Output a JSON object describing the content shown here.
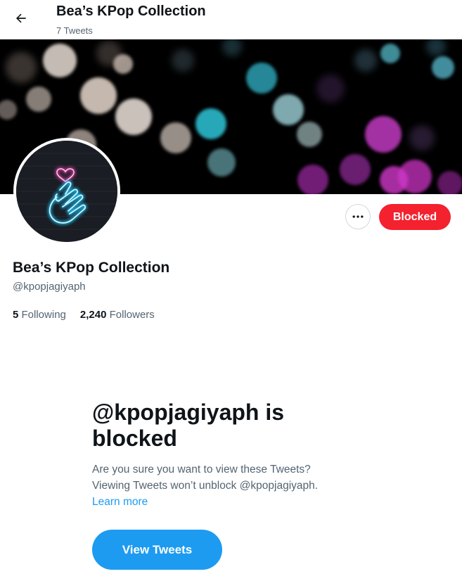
{
  "header": {
    "title": "Bea’s KPop Collection",
    "tweet_count": "7 Tweets",
    "back_icon": "arrow-left-icon"
  },
  "profile": {
    "name": "Bea’s KPop Collection",
    "handle": "@kpopjagiyaph",
    "following_count": "5",
    "following_label": "Following",
    "followers_count": "2,240",
    "followers_label": "Followers",
    "more_icon": "more-horizontal-icon",
    "blocked_button_label": "Blocked"
  },
  "blocked_notice": {
    "title": "@kpopjagiyaph is blocked",
    "line1": "Are you sure you want to view these Tweets?",
    "line2": "Viewing Tweets won’t unblock @kpopjagiyaph.",
    "learn_more": "Learn more",
    "view_button": "View Tweets"
  },
  "colors": {
    "blocked_red": "#f4212e",
    "accent_blue": "#1d9bf0",
    "text_primary": "#0f1419",
    "text_secondary": "#536471"
  }
}
